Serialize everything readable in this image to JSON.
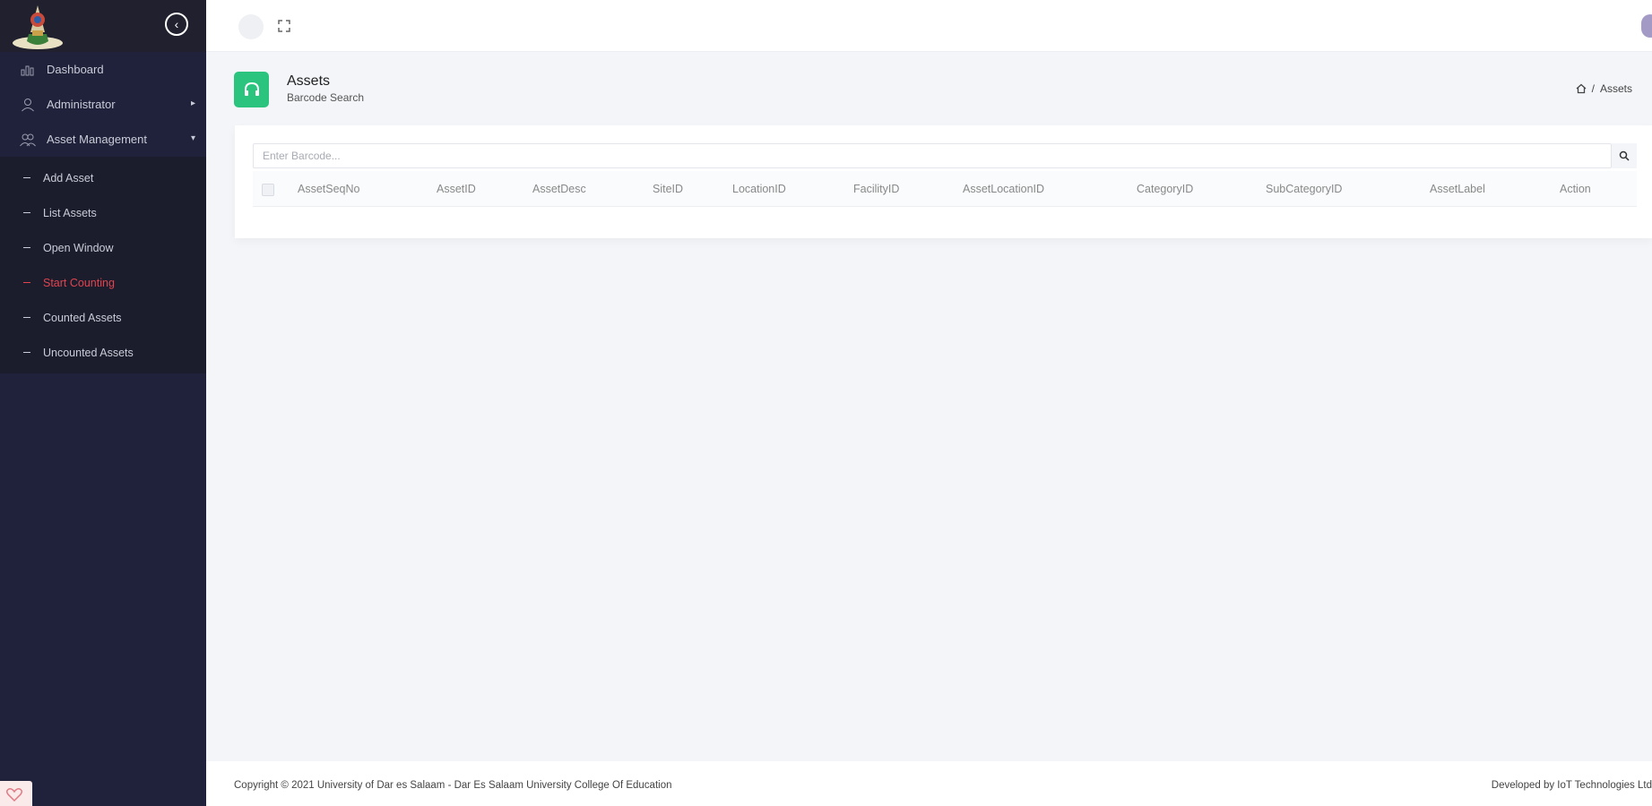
{
  "sidebar": {
    "items": [
      {
        "label": "Dashboard",
        "icon": "chart-icon"
      },
      {
        "label": "Administrator",
        "icon": "user-icon"
      },
      {
        "label": "Asset Management",
        "icon": "users-icon"
      }
    ],
    "submenu": [
      {
        "label": "Add Asset"
      },
      {
        "label": "List Assets"
      },
      {
        "label": "Open Window"
      },
      {
        "label": "Start Counting",
        "active": true
      },
      {
        "label": "Counted Assets"
      },
      {
        "label": "Uncounted Assets"
      }
    ],
    "active_color": "#e04550"
  },
  "page": {
    "title": "Assets",
    "subtitle": "Barcode Search",
    "icon_color": "#2bc47f"
  },
  "breadcrumb": {
    "current": "Assets"
  },
  "search": {
    "placeholder": "Enter Barcode...",
    "value": ""
  },
  "table": {
    "columns": [
      "AssetSeqNo",
      "AssetID",
      "AssetDesc",
      "SiteID",
      "LocationID",
      "FacilityID",
      "AssetLocationID",
      "CategoryID",
      "SubCategoryID",
      "AssetLabel",
      "Action"
    ],
    "rows": []
  },
  "footer": {
    "copyright": "Copyright © 2021 University of Dar es Salaam - Dar Es Salaam University College Of Education",
    "developer": "Developed by IoT Technologies Ltd"
  }
}
